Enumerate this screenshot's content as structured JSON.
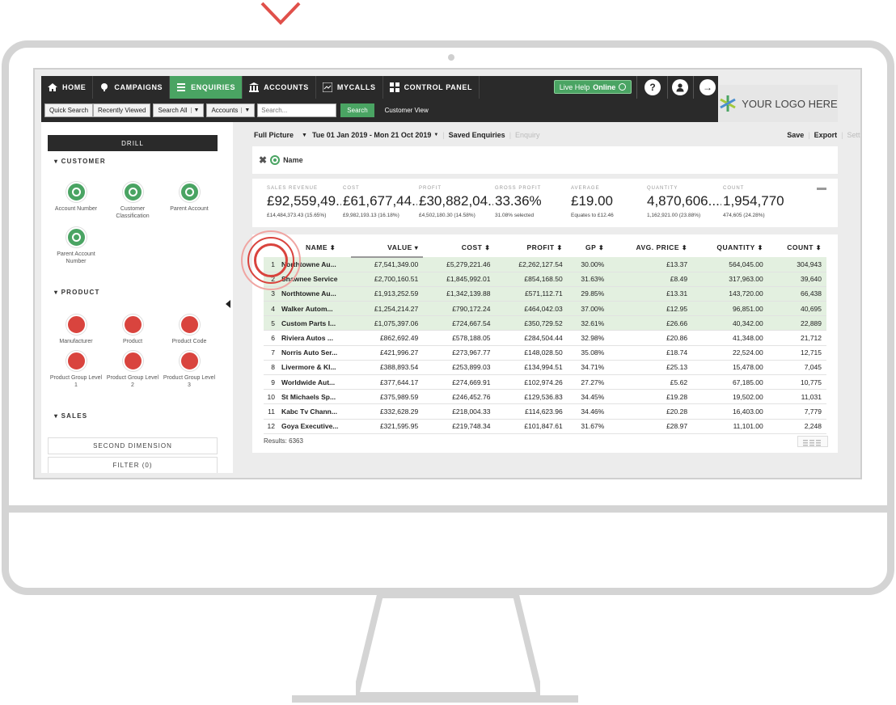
{
  "nav": {
    "items": [
      {
        "label": "HOME",
        "icon": "home-icon",
        "active": false
      },
      {
        "label": "CAMPAIGNS",
        "icon": "campaigns-icon",
        "active": false
      },
      {
        "label": "ENQUIRIES",
        "icon": "enquiries-icon",
        "active": true
      },
      {
        "label": "ACCOUNTS",
        "icon": "accounts-icon",
        "active": false
      },
      {
        "label": "MYCALLS",
        "icon": "mycalls-icon",
        "active": false
      },
      {
        "label": "CONTROL PANEL",
        "icon": "control-panel-icon",
        "active": false
      }
    ],
    "live_help": "Live Help",
    "live_help_status": "Online"
  },
  "searchbar": {
    "quick_search": "Quick Search",
    "recently_viewed": "Recently Viewed",
    "search_all": "Search All",
    "accounts": "Accounts",
    "search_placeholder": "Search...",
    "search_button": "Search",
    "customer_view": "Customer View"
  },
  "logo": {
    "text": "YOUR LOGO HERE"
  },
  "sidebar": {
    "drill": "DRILL",
    "customer_title": "CUSTOMER",
    "customer_items": [
      "Account Number",
      "Customer Classification",
      "Parent Account",
      "Parent Account Number"
    ],
    "product_title": "PRODUCT",
    "product_items": [
      "Manufacturer",
      "Product",
      "Product Code",
      "Product Group Level 1",
      "Product Group Level 2",
      "Product Group Level 3"
    ],
    "sales_title": "SALES",
    "second_dimension": "SECOND DIMENSION",
    "filter": "FILTER (0)"
  },
  "toolbar": {
    "full_picture": "Full Picture",
    "date_range": "Tue 01 Jan 2019 - Mon 21 Oct 2019",
    "saved_enquiries": "Saved Enquiries",
    "enquiry": "Enquiry",
    "save": "Save",
    "export": "Export",
    "settings": "Settings"
  },
  "filter_chip": {
    "label": "Name"
  },
  "kpis": [
    {
      "label": "SALES REVENUE",
      "value": "£92,559,49...",
      "sub": "£14,484,373.43 (15.65%)"
    },
    {
      "label": "COST",
      "value": "£61,677,44...",
      "sub": "£9,982,193.13 (16.18%)"
    },
    {
      "label": "PROFIT",
      "value": "£30,882,04...",
      "sub": "£4,502,180.30 (14.58%)"
    },
    {
      "label": "GROSS PROFIT",
      "value": "33.36%",
      "sub": "31.08% selected"
    },
    {
      "label": "AVERAGE",
      "value": "£19.00",
      "sub": "Equates to £12.46"
    },
    {
      "label": "QUANTITY",
      "value": "4,870,606....",
      "sub": "1,162,921.00 (23.88%)"
    },
    {
      "label": "COUNT",
      "value": "1,954,770",
      "sub": "474,605 (24.28%)"
    }
  ],
  "table": {
    "headers": [
      "NAME",
      "VALUE",
      "COST",
      "PROFIT",
      "GP",
      "AVG. PRICE",
      "QUANTITY",
      "COUNT"
    ],
    "rows": [
      {
        "idx": "1",
        "name": "Northtowne Au...",
        "value": "£7,541,349.00",
        "cost": "£5,279,221.46",
        "profit": "£2,262,127.54",
        "gp": "30.00%",
        "avg": "£13.37",
        "qty": "564,045.00",
        "count": "304,943",
        "hl": true
      },
      {
        "idx": "2",
        "name": "Shawnee Service",
        "value": "£2,700,160.51",
        "cost": "£1,845,992.01",
        "profit": "£854,168.50",
        "gp": "31.63%",
        "avg": "£8.49",
        "qty": "317,963.00",
        "count": "39,640",
        "hl": true
      },
      {
        "idx": "3",
        "name": "Northtowne Au...",
        "value": "£1,913,252.59",
        "cost": "£1,342,139.88",
        "profit": "£571,112.71",
        "gp": "29.85%",
        "avg": "£13.31",
        "qty": "143,720.00",
        "count": "66,438",
        "hl": true
      },
      {
        "idx": "4",
        "name": "Walker Autom...",
        "value": "£1,254,214.27",
        "cost": "£790,172.24",
        "profit": "£464,042.03",
        "gp": "37.00%",
        "avg": "£12.95",
        "qty": "96,851.00",
        "count": "40,695",
        "hl": true
      },
      {
        "idx": "5",
        "name": "Custom Parts I...",
        "value": "£1,075,397.06",
        "cost": "£724,667.54",
        "profit": "£350,729.52",
        "gp": "32.61%",
        "avg": "£26.66",
        "qty": "40,342.00",
        "count": "22,889",
        "hl": true
      },
      {
        "idx": "6",
        "name": "Riviera Autos ...",
        "value": "£862,692.49",
        "cost": "£578,188.05",
        "profit": "£284,504.44",
        "gp": "32.98%",
        "avg": "£20.86",
        "qty": "41,348.00",
        "count": "21,712",
        "hl": false
      },
      {
        "idx": "7",
        "name": "Norris Auto Ser...",
        "value": "£421,996.27",
        "cost": "£273,967.77",
        "profit": "£148,028.50",
        "gp": "35.08%",
        "avg": "£18.74",
        "qty": "22,524.00",
        "count": "12,715",
        "hl": false
      },
      {
        "idx": "8",
        "name": "Livermore & Kl...",
        "value": "£388,893.54",
        "cost": "£253,899.03",
        "profit": "£134,994.51",
        "gp": "34.71%",
        "avg": "£25.13",
        "qty": "15,478.00",
        "count": "7,045",
        "hl": false
      },
      {
        "idx": "9",
        "name": "Worldwide Aut...",
        "value": "£377,644.17",
        "cost": "£274,669.91",
        "profit": "£102,974.26",
        "gp": "27.27%",
        "avg": "£5.62",
        "qty": "67,185.00",
        "count": "10,775",
        "hl": false
      },
      {
        "idx": "10",
        "name": "St Michaels Sp...",
        "value": "£375,989.59",
        "cost": "£246,452.76",
        "profit": "£129,536.83",
        "gp": "34.45%",
        "avg": "£19.28",
        "qty": "19,502.00",
        "count": "11,031",
        "hl": false
      },
      {
        "idx": "11",
        "name": "Kabc Tv Chann...",
        "value": "£332,628.29",
        "cost": "£218,004.33",
        "profit": "£114,623.96",
        "gp": "34.46%",
        "avg": "£20.28",
        "qty": "16,403.00",
        "count": "7,779",
        "hl": false
      },
      {
        "idx": "12",
        "name": "Goya Executive...",
        "value": "£321,595.95",
        "cost": "£219,748.34",
        "profit": "£101,847.61",
        "gp": "31.67%",
        "avg": "£28.97",
        "qty": "11,101.00",
        "count": "2,248",
        "hl": false
      }
    ],
    "results": "Results: 6363"
  },
  "colors": {
    "accent": "#4aa463",
    "nav_bg": "#2a2a2a",
    "dim_red": "#d9443e"
  }
}
